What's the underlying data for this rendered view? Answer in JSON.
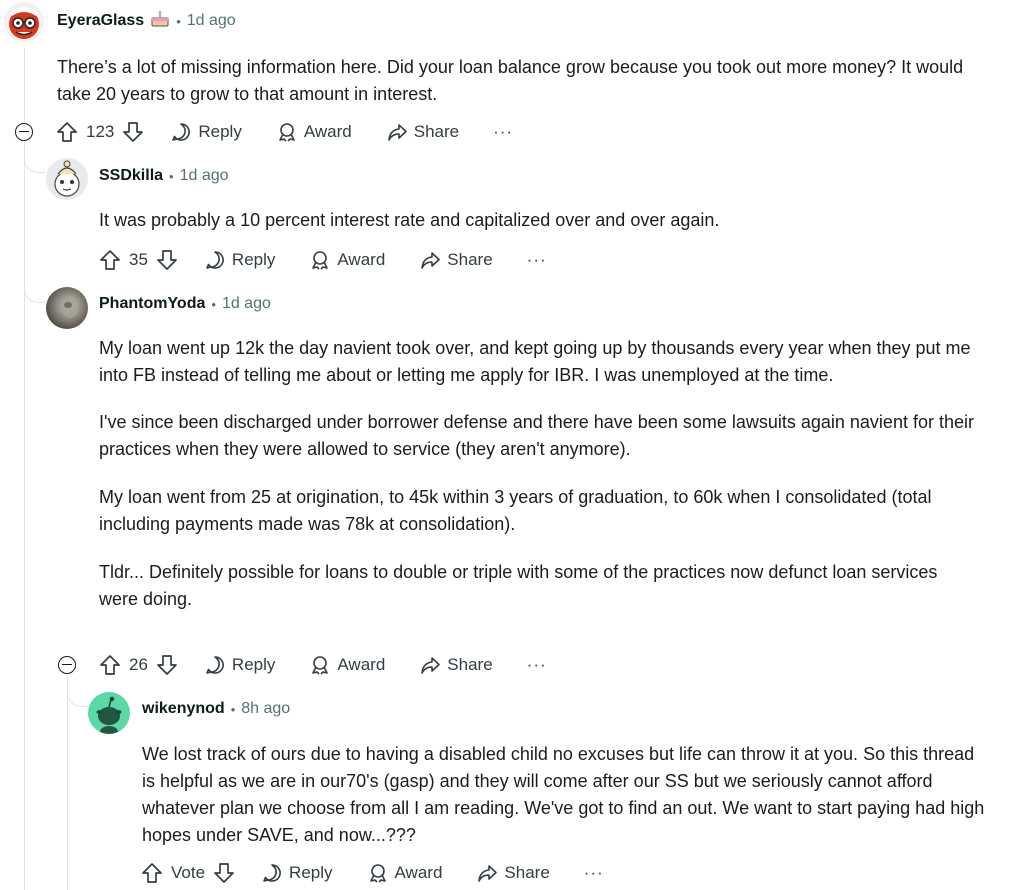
{
  "comments": [
    {
      "username": "EyeraGlass",
      "flair_icon": "cake-icon",
      "time": "1d ago",
      "body": [
        "There’s a lot of missing information here. Did your loan balance grow because you took out more money? It would take 20 years to grow to that amount in interest."
      ],
      "score": "123",
      "reply_label": "Reply",
      "award_label": "Award",
      "share_label": "Share",
      "more_label": "···"
    },
    {
      "username": "SSDkilla",
      "time": "1d ago",
      "body": [
        "It was probably a 10 percent interest rate and capitalized over and over again."
      ],
      "score": "35",
      "reply_label": "Reply",
      "award_label": "Award",
      "share_label": "Share",
      "more_label": "···"
    },
    {
      "username": "PhantomYoda",
      "time": "1d ago",
      "body": [
        "My loan went up 12k the day navient took over, and kept going up by thousands every year when they put me into FB instead of telling me about or letting me apply for IBR. I was unemployed at the time.",
        "I've since been discharged under borrower defense and there have been some lawsuits again navient for their practices when they were allowed to service (they aren't anymore).",
        "My loan went from 25 at origination, to 45k within 3 years of graduation, to 60k when I consolidated (total including payments made was 78k at consolidation).",
        "Tldr... Definitely possible for loans to double or triple with some of the practices now defunct loan services were doing."
      ],
      "score": "26",
      "reply_label": "Reply",
      "award_label": "Award",
      "share_label": "Share",
      "more_label": "···"
    },
    {
      "username": "wikenynod",
      "time": "8h ago",
      "body": [
        "We lost track of ours due to having a disabled child no excuses but life can throw it at you. So this thread is helpful as we are in our70's (gasp) and they will come after our SS but we seriously cannot afford whatever plan we choose from all I am reading. We've got to find an out. We want to start paying had high hopes under SAVE, and now...???"
      ],
      "score": "Vote",
      "reply_label": "Reply",
      "award_label": "Award",
      "share_label": "Share",
      "more_label": "···"
    }
  ],
  "colors": {
    "text": "#0f1a1c",
    "meta": "#576f76",
    "thread_line": "#dfe3e6",
    "avatar_green": "#5ad8a6"
  }
}
